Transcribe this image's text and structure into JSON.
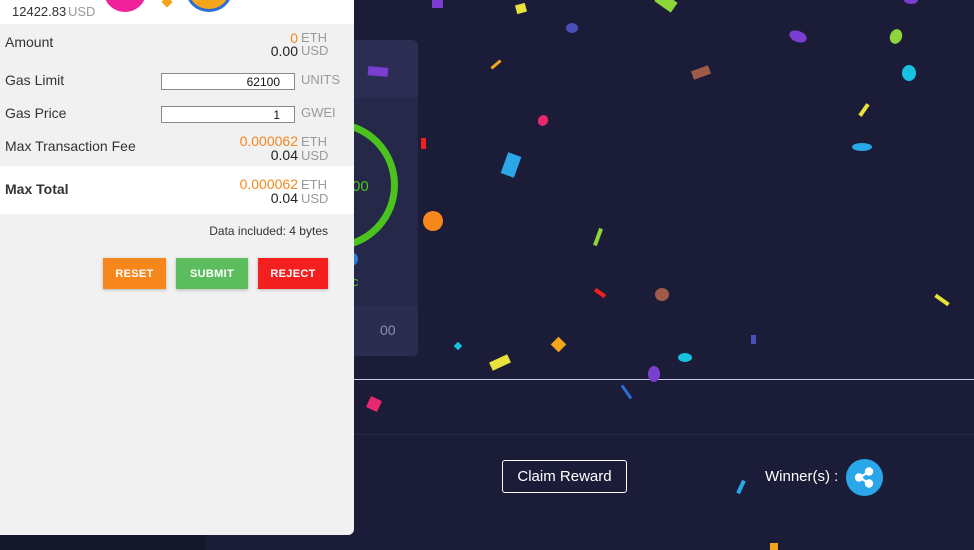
{
  "wallet": {
    "balance_usd": "12422.83",
    "balance_usd_unit": "USD",
    "amount": {
      "label": "Amount",
      "eth": "0",
      "eth_unit": "ETH",
      "usd": "0.00",
      "usd_unit": "USD"
    },
    "gas_limit": {
      "label": "Gas Limit",
      "value": "62100",
      "unit": "UNITS"
    },
    "gas_price": {
      "label": "Gas Price",
      "value": "1",
      "unit": "GWEI"
    },
    "max_fee": {
      "label": "Max Transaction Fee",
      "eth": "0.000062",
      "eth_unit": "ETH",
      "usd": "0.04",
      "usd_unit": "USD"
    },
    "max_total": {
      "label": "Max Total",
      "eth": "0.000062",
      "eth_unit": "ETH",
      "usd": "0.04",
      "usd_unit": "USD"
    },
    "data_included": "Data included: 4 bytes",
    "buttons": {
      "reset": "RESET",
      "submit": "SUBMIT",
      "reject": "REJECT"
    },
    "colors": {
      "reset": "#f7861c",
      "submit": "#5cbd5e",
      "reject": "#f42020",
      "eth_amount": "#f7861c"
    }
  },
  "dapp": {
    "ring_value": "00",
    "ring_sub": "c",
    "card_footer_value": "00",
    "claim_button": "Claim Reward",
    "winner_label": "Winner(s) :",
    "winner_avatar_icon": "ripple-logo-icon",
    "colors": {
      "background": "#1b1d38",
      "ring": "#4cc21f",
      "avatar": "#2aa7e8"
    }
  }
}
